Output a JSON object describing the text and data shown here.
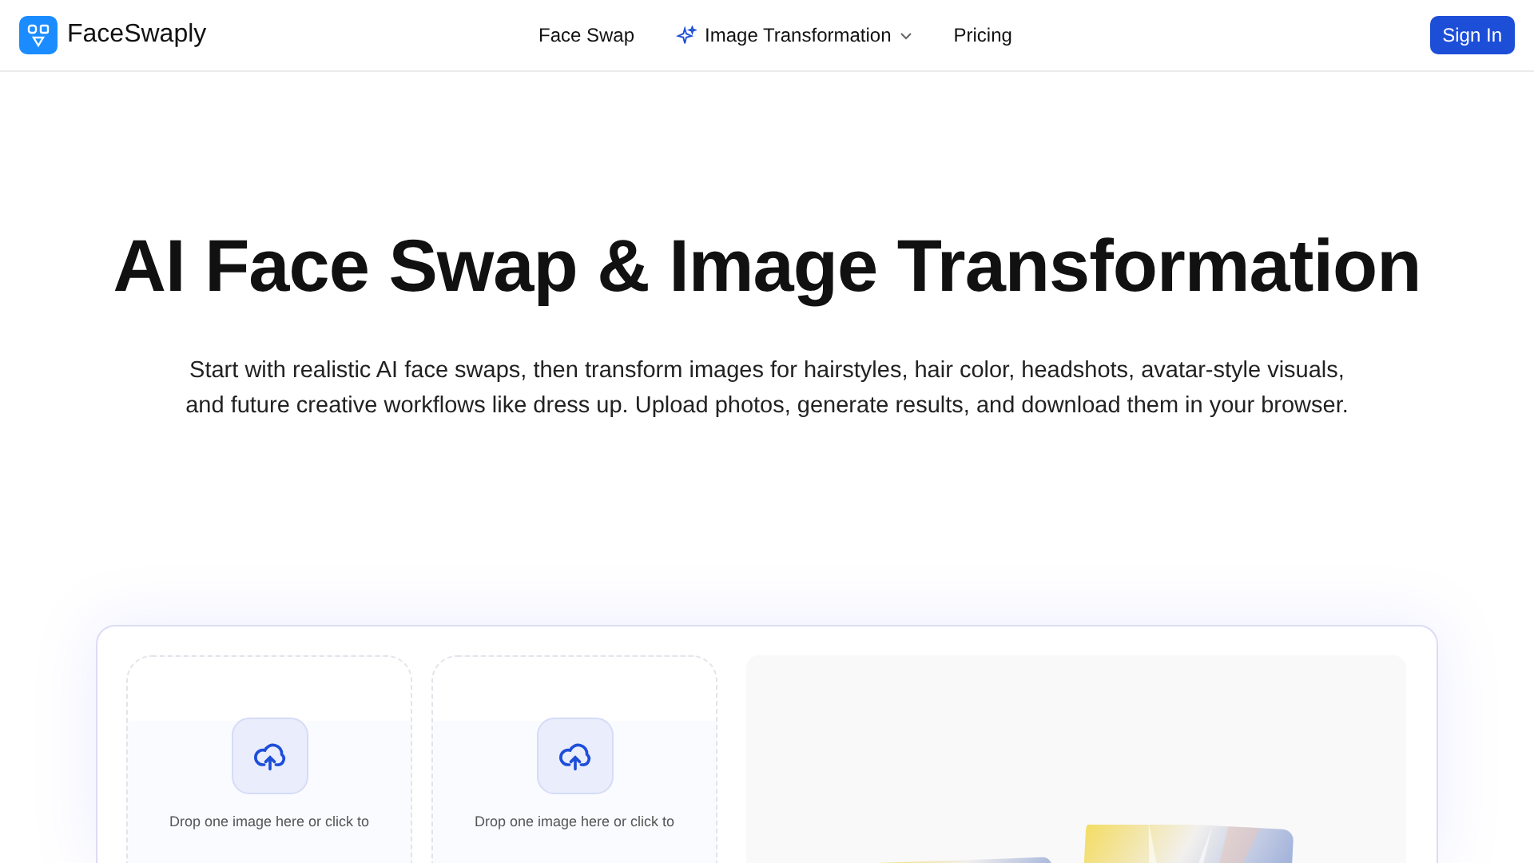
{
  "header": {
    "brand": "FaceSwaply",
    "nav": [
      {
        "label": "Face Swap",
        "kind": "link"
      },
      {
        "label": "Image Transformation",
        "kind": "dropdown"
      },
      {
        "label": "Pricing",
        "kind": "link"
      }
    ],
    "sign_in": "Sign In"
  },
  "hero": {
    "title": "AI Face Swap & Image Transformation",
    "subtitle": "Start with realistic AI face swaps, then transform images for hairstyles, hair color, headshots, avatar-style visuals, and future creative workflows like dress up. Upload photos, generate results, and download them in your browser."
  },
  "uploads": [
    {
      "hint": "Drop one image here or click to"
    },
    {
      "hint": "Drop one image here or click to"
    }
  ]
}
